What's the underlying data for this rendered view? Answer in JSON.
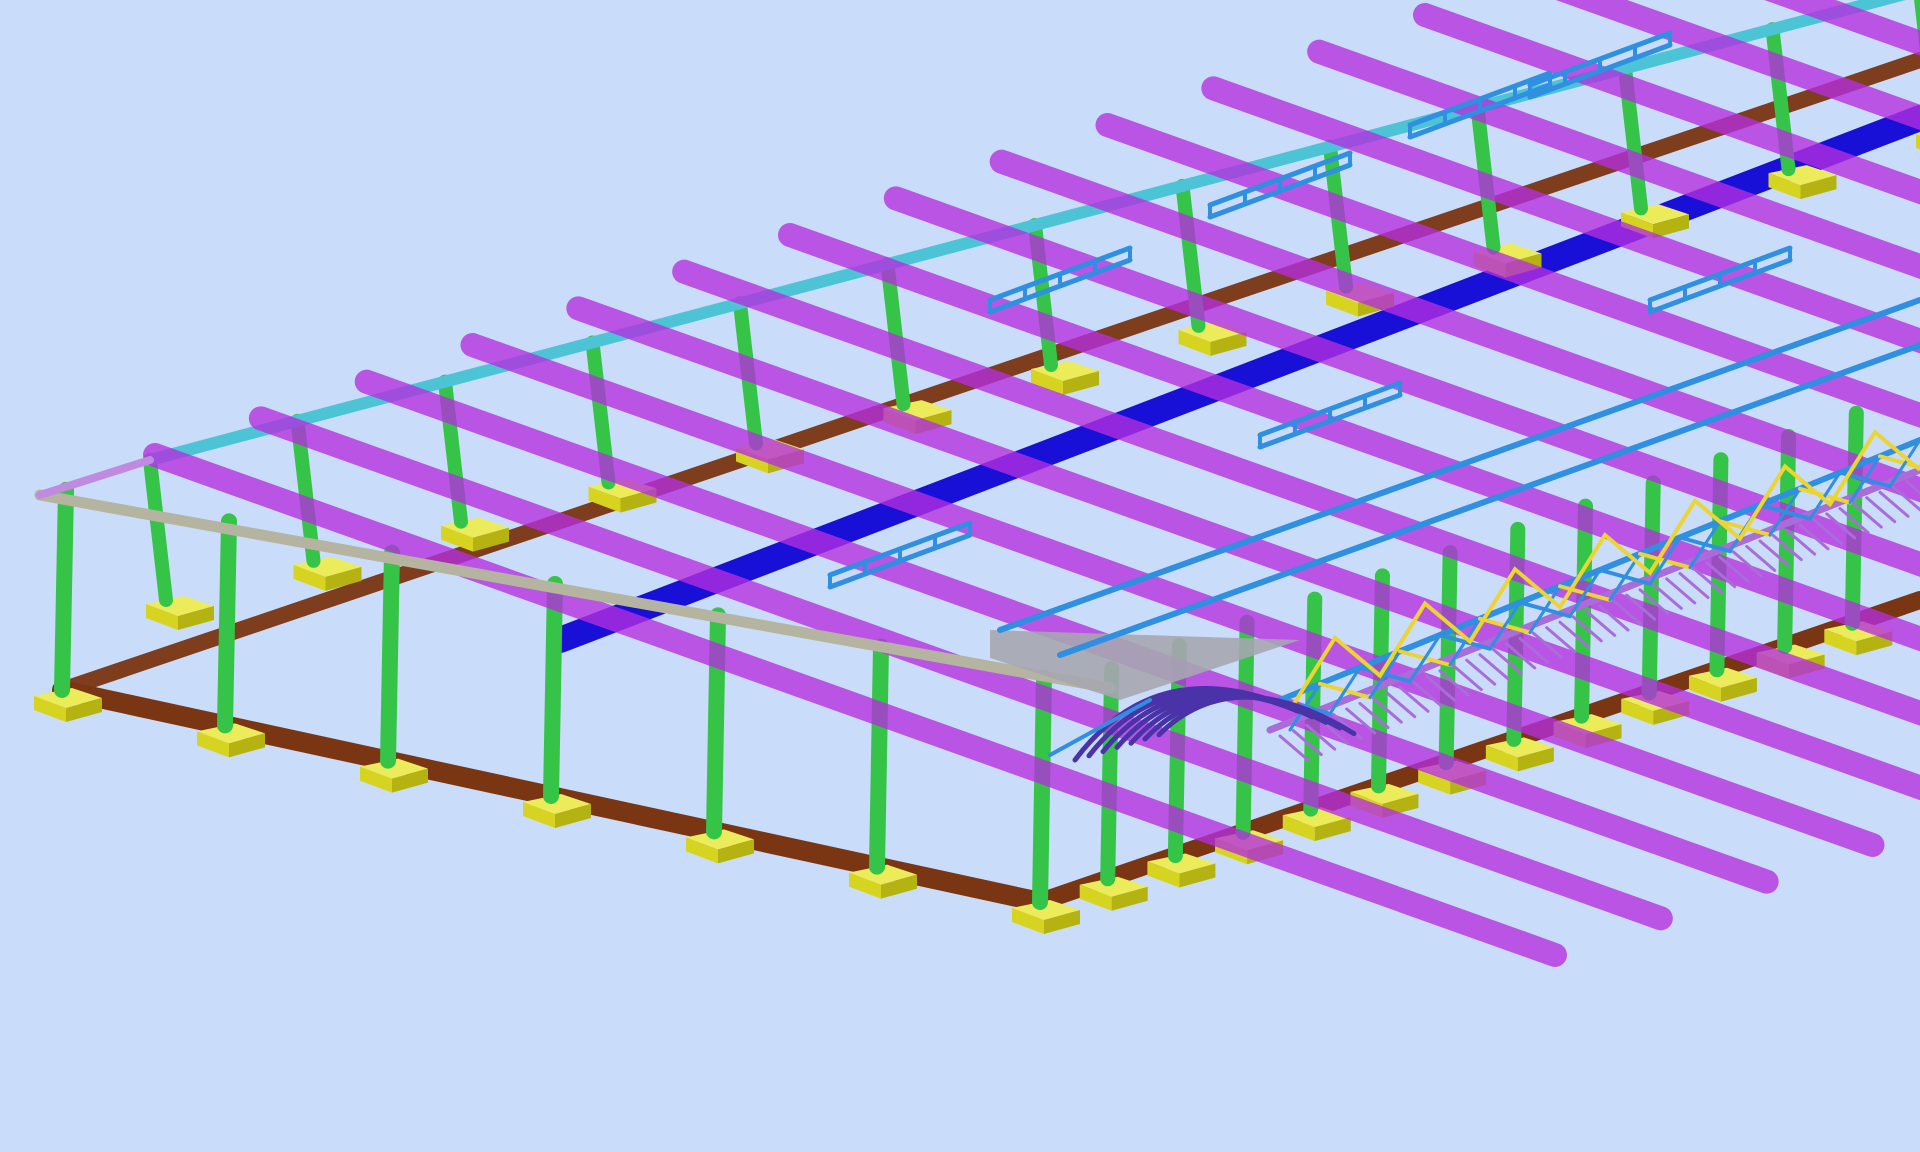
{
  "viewport": {
    "background": "#c9dcf9",
    "view": "3d-isometric-structural-model"
  },
  "legend_colors": {
    "ground_beam": "#7a3512",
    "footing": "#d7d421",
    "column": "#35c447",
    "rafter": "#b62ee0",
    "eave_beam": "#4cc4d6",
    "edge_beam": "#b4b4a0",
    "spine_beam": "#1810d6",
    "bracing": "#2f8fe0",
    "truss_chord": "#a96cd9",
    "truss_web": "#ecd431",
    "arch_rib": "#4a32a8",
    "plate": "#a6a6b0"
  },
  "model": {
    "bay_count": 12,
    "side_columns": 12,
    "front_columns": 6,
    "ladder_braces": 7,
    "truss_panels": 16,
    "arch_ribs": 7
  }
}
